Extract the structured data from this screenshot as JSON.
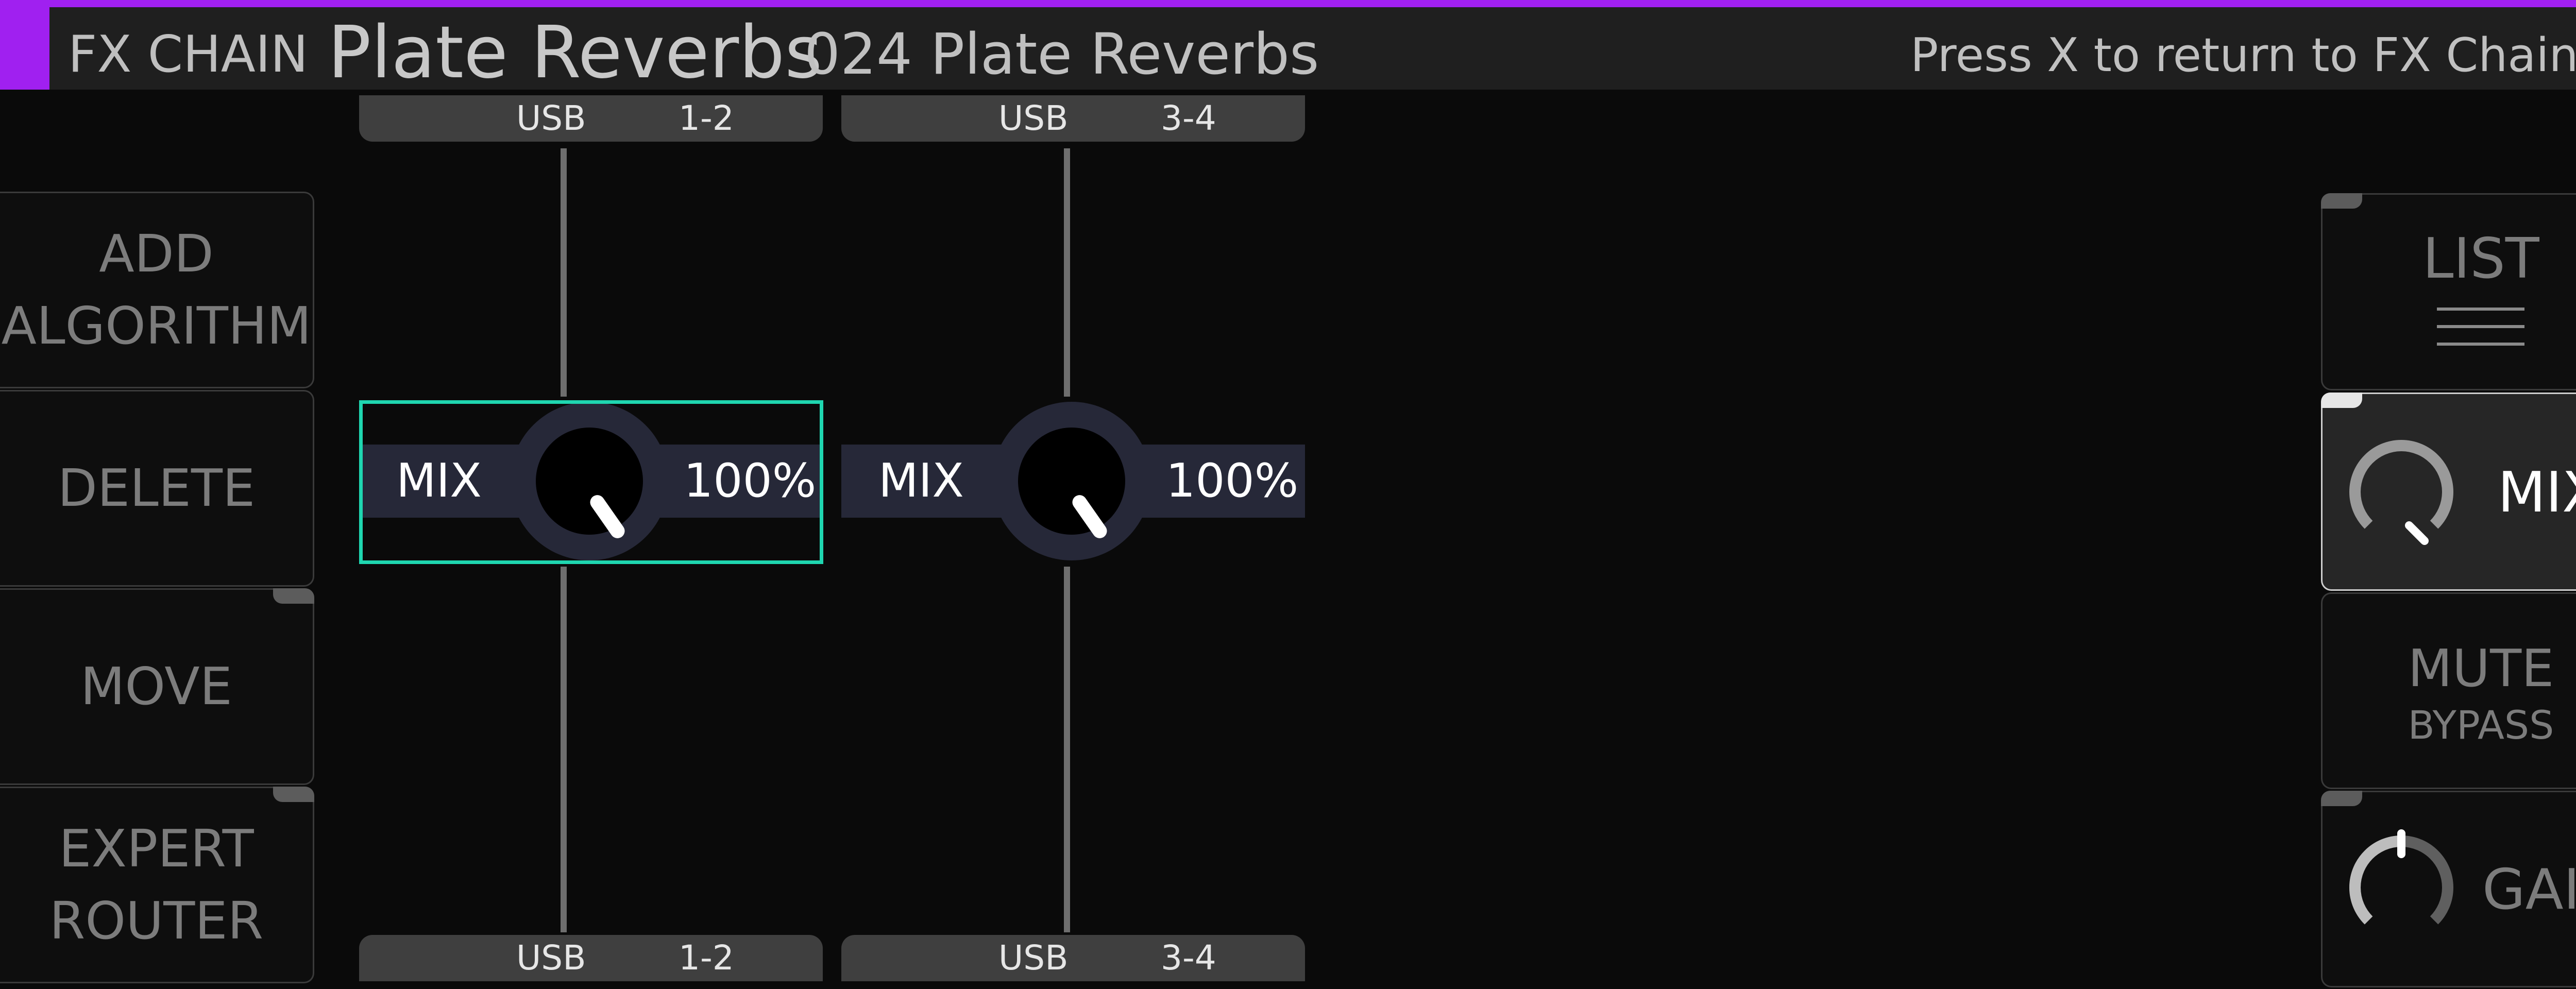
{
  "header": {
    "section": "FX CHAIN",
    "title": "Plate Reverbs",
    "preset": "024 Plate Reverbs",
    "hint": "Press X to return to FX Chains."
  },
  "left_buttons": {
    "add_algorithm_line1": "ADD",
    "add_algorithm_line2": "ALGORITHM",
    "delete": "DELETE",
    "move": "MOVE",
    "expert_router_line1": "EXPERT",
    "expert_router_line2": "ROUTER"
  },
  "chains": [
    {
      "input_name": "USB",
      "input_channels": "1-2",
      "output_name": "USB",
      "output_channels": "1-2",
      "param_label": "MIX",
      "param_value": "100%"
    },
    {
      "input_name": "USB",
      "input_channels": "3-4",
      "output_name": "USB",
      "output_channels": "3-4",
      "param_label": "MIX",
      "param_value": "100%"
    }
  ],
  "right_buttons": {
    "list": "LIST",
    "mix": "MIX",
    "mute": "MUTE",
    "bypass": "BYPASS",
    "gain": "GAIN"
  },
  "colors": {
    "accent": "#a020f0",
    "selection": "#1fd6b0",
    "band": "#262838"
  },
  "icons": [
    "list-icon",
    "mix-knob-icon",
    "gain-knob-icon"
  ]
}
